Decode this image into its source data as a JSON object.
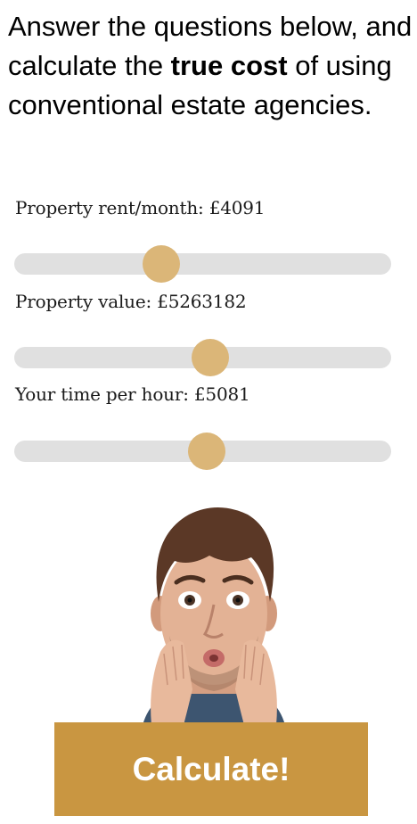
{
  "intro": {
    "text_before": "Answer the questions below, and calculate the ",
    "text_bold": "true cost",
    "text_after": " of using conventional estate agencies."
  },
  "sliders": [
    {
      "label": "Property rent/month: £4091",
      "fraction": 0.39
    },
    {
      "label": "Property value: £5263182",
      "fraction": 0.52
    },
    {
      "label": "Your time per hour: £5081",
      "fraction": 0.51
    }
  ],
  "colors": {
    "thumb": "#dbb678",
    "track": "#e0e0e0",
    "button": "#c99641"
  },
  "image": {
    "description_icon": "surprised-man-photo"
  },
  "button": {
    "label": "Calculate!"
  }
}
